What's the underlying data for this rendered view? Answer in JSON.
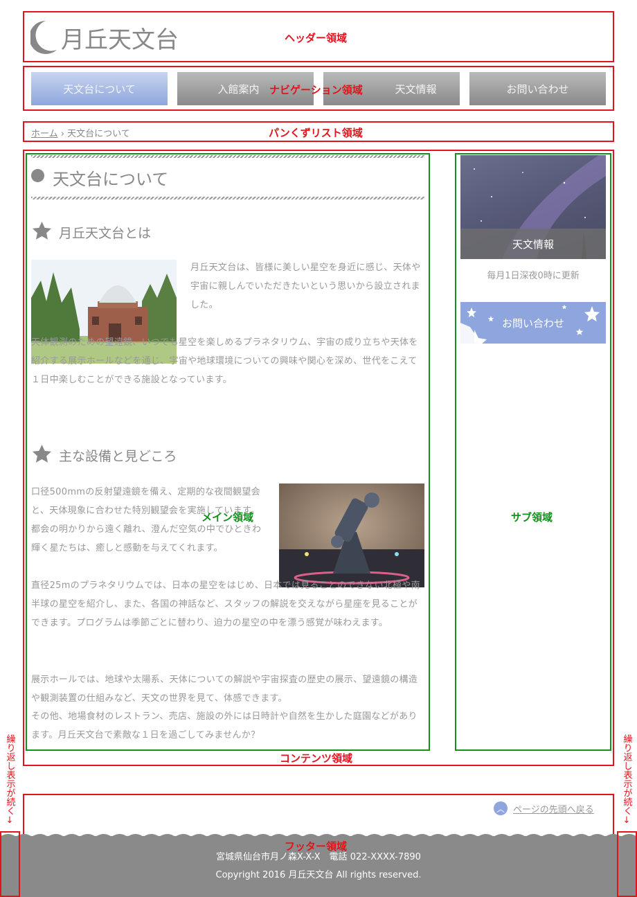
{
  "header": {
    "logo_text": "月丘天文台",
    "region_label": "ヘッダー領域"
  },
  "nav": {
    "items": [
      {
        "label": "天文台について"
      },
      {
        "label": "入館案内"
      },
      {
        "label": "天文情報"
      },
      {
        "label": "お問い合わせ"
      }
    ],
    "region_label": "ナビゲーション領域"
  },
  "breadcrumb": {
    "home": "ホーム",
    "separator": "›",
    "current": "天文台について",
    "region_label": "パンくずリスト領域"
  },
  "main": {
    "title": "天文台について",
    "section1": {
      "heading": "月丘天文台とは",
      "p1": "月丘天文台は、皆様に美しい星空を身近に感じ、天体や宇宙に親しんでいただきたいという思いから設立されました。",
      "p2": "天体観測のための望遠鏡、いつでも星空を楽しめるプラネタリウム、宇宙の成り立ちや天体を紹介する展示ホールなどを通じ、宇宙や地球環境についての興味や関心を深め、世代をこえて１日中楽しむことができる施設となっています。"
    },
    "section2": {
      "heading": "主な設備と見どころ",
      "p1": "口径500mmの反射望遠鏡を備え、定期的な夜間観望会と、天体現象に合わせた特別観望会を実施しています。都会の明かりから遠く離れ、澄んだ空気の中でひときわ輝く星たちは、癒しと感動を与えてくれます。",
      "p2": "直径25mのプラネタリウムでは、日本の星空をはじめ、日本では見ることのできない北極や南半球の星空を紹介し、また、各国の神話など、スタッフの解説を交えながら星座を見ることができます。プログラムは季節ごとに替わり、迫力の星空の中を漂う感覚が味わえます。",
      "p3a": "展示ホールでは、地球や太陽系、天体についての解説や宇宙探査の歴史の展示、望遠鏡の構造や観測装置の仕組みなど、天文の世界を見て、体感できます。",
      "p3b": "その他、地場食材のレストラン、売店、施設の外には日時計や自然を生かした庭園などがあります。月丘天文台で素敵な１日を過ごしてみませんか？"
    },
    "region_label": "メイン領域"
  },
  "sub": {
    "banner1_label": "天文情報",
    "banner1_caption": "毎月1日深夜0時に更新",
    "banner2_label": "お問い合わせ",
    "region_label": "サブ領域"
  },
  "content": {
    "region_label": "コンテンツ領域"
  },
  "footer": {
    "page_top": "ページの先頭へ戻る",
    "address": "宮城県仙台市月ノ森X-X-X　電話 022-XXXX-7890",
    "copyright": "Copyright 2016 月丘天文台 All rights reserved.",
    "region_label": "フッター領域"
  },
  "side_note": {
    "text": "繰り返し表示が続く",
    "arrow": "↓"
  },
  "colors": {
    "region_red": "#e1141c",
    "region_green": "#12911b",
    "nav_active": "#8ea6dd",
    "footer_bg": "#8a8a8a"
  }
}
